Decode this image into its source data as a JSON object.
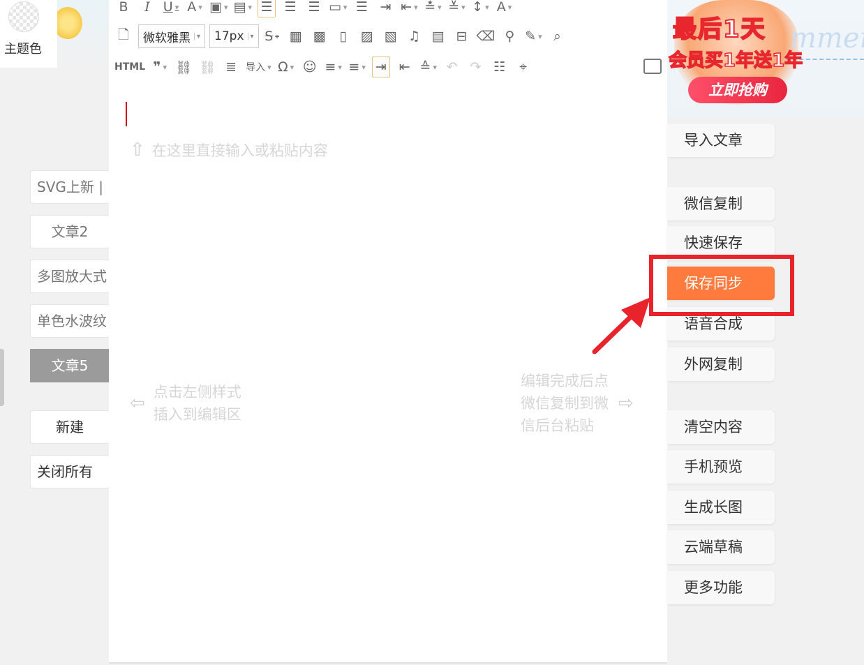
{
  "theme": {
    "label": "主题色"
  },
  "articles": [
    {
      "label": "SVG上新 |"
    },
    {
      "label": "文章2"
    },
    {
      "label": "多图放大式"
    },
    {
      "label": "单色水波纹"
    },
    {
      "label": "文章5"
    }
  ],
  "left_actions": {
    "new": "新建",
    "close_all": "关闭所有"
  },
  "toolbar": {
    "font_family": "微软雅黑",
    "font_size": "17px",
    "html_label": "HTML",
    "import_label": "导入"
  },
  "editor": {
    "hint_top": "在这里直接输入或粘贴内容",
    "hint_left_1": "点击左侧样式",
    "hint_left_2": "插入到编辑区",
    "hint_right_1": "编辑完成后点",
    "hint_right_2": "微信复制到微",
    "hint_right_3": "信后台粘贴"
  },
  "promo": {
    "line1": "最后1天",
    "line2": "会员买1年送1年",
    "cta": "立即抢购",
    "deco": "mmer"
  },
  "side_buttons": [
    {
      "label": "导入文章"
    },
    {
      "label": "微信复制"
    },
    {
      "label": "快速保存"
    },
    {
      "label": "保存同步"
    },
    {
      "label": "语音合成"
    },
    {
      "label": "外网复制"
    },
    {
      "label": "清空内容"
    },
    {
      "label": "手机预览"
    },
    {
      "label": "生成长图"
    },
    {
      "label": "云端草稿"
    },
    {
      "label": "更多功能"
    }
  ],
  "colors": {
    "primary": "#ff7a3d",
    "active_tab": "#9b9b9b",
    "annotation": "#e8232c",
    "cursor": "#d0021b"
  }
}
